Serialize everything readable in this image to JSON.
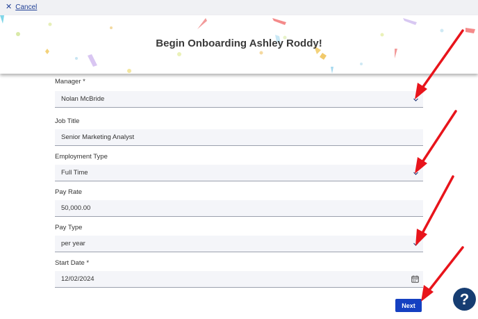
{
  "topbar": {
    "cancel_icon": "close-icon",
    "cancel_label": "Cancel"
  },
  "banner": {
    "title": "Begin Onboarding Ashley Roddy!"
  },
  "form": {
    "manager": {
      "label": "Manager *",
      "value": "Nolan McBride",
      "icon": "chevron-down-icon"
    },
    "job_title": {
      "label": "Job Title",
      "value": "Senior Marketing Analyst"
    },
    "employment_type": {
      "label": "Employment Type",
      "value": "Full Time",
      "icon": "chevron-down-icon"
    },
    "pay_rate": {
      "label": "Pay Rate",
      "value": "50,000.00"
    },
    "pay_type": {
      "label": "Pay Type",
      "value": "per year",
      "icon": "chevron-down-icon"
    },
    "start_date": {
      "label": "Start Date *",
      "value": "12/02/2024",
      "icon": "calendar-icon"
    }
  },
  "actions": {
    "next_label": "Next"
  },
  "help": {
    "label": "?"
  },
  "colors": {
    "primary": "#1540c1",
    "help": "#163d72",
    "link": "#1f3f95",
    "annotation": "#e8141b",
    "field_bg": "#f4f5f9"
  }
}
